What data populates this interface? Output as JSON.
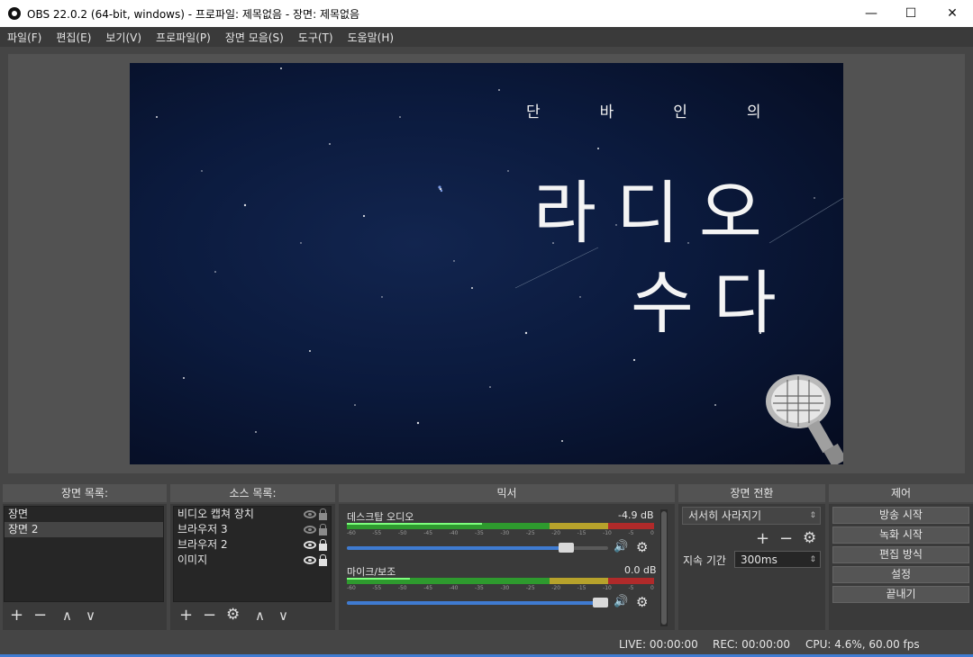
{
  "window": {
    "title": "OBS 22.0.2 (64-bit, windows) - 프로파일: 제목없음 - 장면: 제목없음",
    "minimize": "—",
    "maximize": "☐",
    "close": "✕"
  },
  "menu": [
    "파일(F)",
    "편집(E)",
    "보기(V)",
    "프로파일(P)",
    "장면 모음(S)",
    "도구(T)",
    "도움말(H)"
  ],
  "preview": {
    "line1": "단바인의",
    "line2": "라디오",
    "line3": "수다"
  },
  "docks": {
    "scenes": "장면 목록:",
    "sources": "소스 목록:",
    "mixer": "믹서",
    "transitions": "장면 전환",
    "controls": "제어"
  },
  "scenes": [
    {
      "name": "장면",
      "selected": false
    },
    {
      "name": "장면 2",
      "selected": true
    }
  ],
  "sources": [
    {
      "name": "비디오 캡쳐 장치",
      "visible": false,
      "locked": false
    },
    {
      "name": "브라우저 3",
      "visible": false,
      "locked": false
    },
    {
      "name": "브라우저 2",
      "visible": true,
      "locked": true
    },
    {
      "name": "이미지",
      "visible": true,
      "locked": true
    }
  ],
  "mixer": {
    "channels": [
      {
        "name": "데스크탑 오디오",
        "level": "-4.9 dB",
        "volume_fraction": 0.86
      },
      {
        "name": "마이크/보조",
        "level": "0.0 dB",
        "volume_fraction": 1.0
      }
    ],
    "ticks": [
      "-60",
      "-55",
      "-50",
      "-45",
      "-40",
      "-35",
      "-30",
      "-25",
      "-20",
      "-15",
      "-10",
      "-5",
      "0"
    ]
  },
  "transitions": {
    "selected": "서서히 사라지기",
    "duration_label": "지속 기간",
    "duration_value": "300ms"
  },
  "controls": [
    "방송 시작",
    "녹화 시작",
    "편집 방식",
    "설정",
    "끝내기"
  ],
  "status": {
    "live": "LIVE: 00:00:00",
    "rec": "REC: 00:00:00",
    "cpu": "CPU: 4.6%, 60.00 fps"
  },
  "colors": {
    "accent": "#3f7bd1",
    "meter_green": "#2e9a2e",
    "meter_yellow": "#b7a22b",
    "meter_red": "#b02a2a"
  },
  "icons": {
    "add": "+",
    "remove": "−",
    "up": "∧",
    "down": "∨",
    "settings": "⚙",
    "speaker": "🔊"
  }
}
